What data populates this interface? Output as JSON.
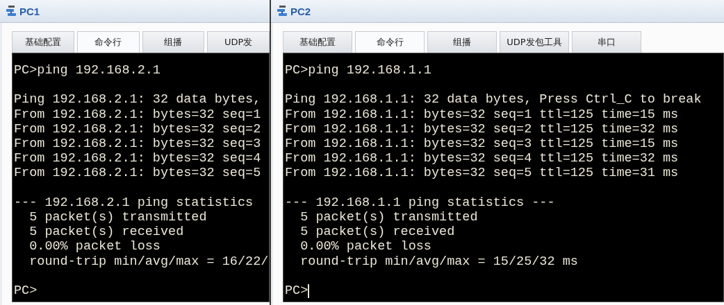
{
  "windows": [
    {
      "title": "PC1",
      "tabs": [
        {
          "label": "基础配置",
          "selected": false
        },
        {
          "label": "命令行",
          "selected": true
        },
        {
          "label": "组播",
          "selected": false
        },
        {
          "label": "UDP发",
          "selected": false
        }
      ],
      "terminal": {
        "blocks": [
          [
            "PC>ping 192.168.2.1"
          ],
          [
            "Ping 192.168.2.1: 32 data bytes,",
            "From 192.168.2.1: bytes=32 seq=1",
            "From 192.168.2.1: bytes=32 seq=2",
            "From 192.168.2.1: bytes=32 seq=3",
            "From 192.168.2.1: bytes=32 seq=4",
            "From 192.168.2.1: bytes=32 seq=5"
          ],
          [
            "--- 192.168.2.1 ping statistics",
            "  5 packet(s) transmitted",
            "  5 packet(s) received",
            "  0.00% packet loss",
            "  round-trip min/avg/max = 16/22/"
          ]
        ],
        "prompt": "PC>",
        "cursor": false
      }
    },
    {
      "title": "PC2",
      "tabs": [
        {
          "label": "基础配置",
          "selected": false
        },
        {
          "label": "命令行",
          "selected": true
        },
        {
          "label": "组播",
          "selected": false
        },
        {
          "label": "UDP发包工具",
          "selected": false
        },
        {
          "label": "串口",
          "selected": false
        }
      ],
      "terminal": {
        "blocks": [
          [
            "PC>ping 192.168.1.1"
          ],
          [
            "Ping 192.168.1.1: 32 data bytes, Press Ctrl_C to break",
            "From 192.168.1.1: bytes=32 seq=1 ttl=125 time=15 ms",
            "From 192.168.1.1: bytes=32 seq=2 ttl=125 time=32 ms",
            "From 192.168.1.1: bytes=32 seq=3 ttl=125 time=15 ms",
            "From 192.168.1.1: bytes=32 seq=4 ttl=125 time=32 ms",
            "From 192.168.1.1: bytes=32 seq=5 ttl=125 time=31 ms"
          ],
          [
            "--- 192.168.1.1 ping statistics ---",
            "  5 packet(s) transmitted",
            "  5 packet(s) received",
            "  0.00% packet loss",
            "  round-trip min/avg/max = 15/25/32 ms"
          ]
        ],
        "prompt": "PC>",
        "cursor": true
      }
    }
  ]
}
